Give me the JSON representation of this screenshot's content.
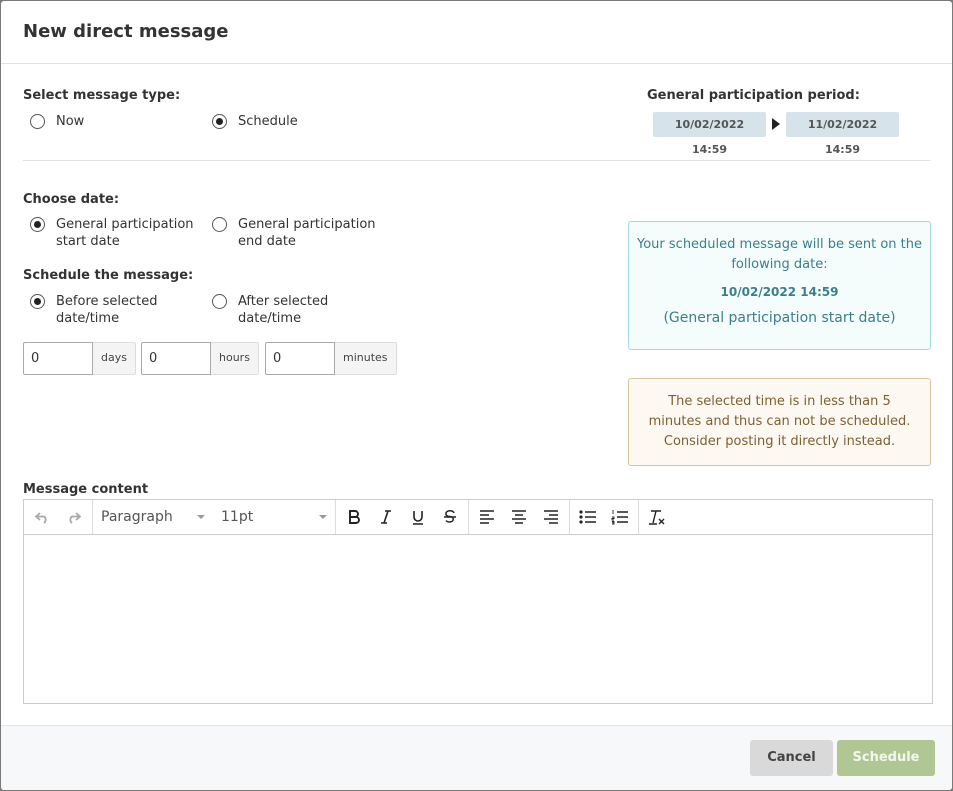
{
  "dialog": {
    "title": "New direct message"
  },
  "message_type": {
    "label": "Select message type:",
    "options": [
      {
        "label": "Now",
        "checked": false
      },
      {
        "label": "Schedule",
        "checked": true
      }
    ]
  },
  "participation_period": {
    "label": "General participation period:",
    "start": "10/02/2022 14:59",
    "end": "11/02/2022 14:59"
  },
  "choose_date": {
    "label": "Choose date:",
    "options": [
      {
        "line1": "General participation",
        "line2": "start date",
        "checked": true
      },
      {
        "line1": "General participation",
        "line2": "end date",
        "checked": false
      }
    ]
  },
  "schedule_message": {
    "label": "Schedule the message:",
    "options": [
      {
        "line1": "Before selected",
        "line2": "date/time",
        "checked": true
      },
      {
        "line1": "After selected",
        "line2": "date/time",
        "checked": false
      }
    ]
  },
  "offset": {
    "days": {
      "value": "0",
      "unit": "days"
    },
    "hours": {
      "value": "0",
      "unit": "hours"
    },
    "minutes": {
      "value": "0",
      "unit": "minutes"
    }
  },
  "info": {
    "line1": "Your scheduled message will be sent on the",
    "line2": "following date:",
    "date": "10/02/2022 14:59",
    "note": "(General participation start date)"
  },
  "warning": {
    "text": "The selected time is in less than 5 minutes and thus can not be scheduled. Consider posting it directly instead."
  },
  "editor": {
    "label": "Message content",
    "block_format": "Paragraph",
    "font_size": "11pt",
    "icons": [
      "undo-icon",
      "redo-icon",
      "bold-icon",
      "italic-icon",
      "underline-icon",
      "strikethrough-icon",
      "align-left-icon",
      "align-center-icon",
      "align-right-icon",
      "bullet-list-icon",
      "numbered-list-icon",
      "clear-formatting-icon"
    ]
  },
  "footer": {
    "cancel": "Cancel",
    "schedule": "Schedule"
  },
  "colors": {
    "info_text": "#3a7f8c",
    "info_border": "#a6d8df",
    "warning_text": "#7d6133",
    "warning_border": "#d9c39d",
    "schedule_button": "#b0c794",
    "period_chip": "#d7e3ea"
  }
}
